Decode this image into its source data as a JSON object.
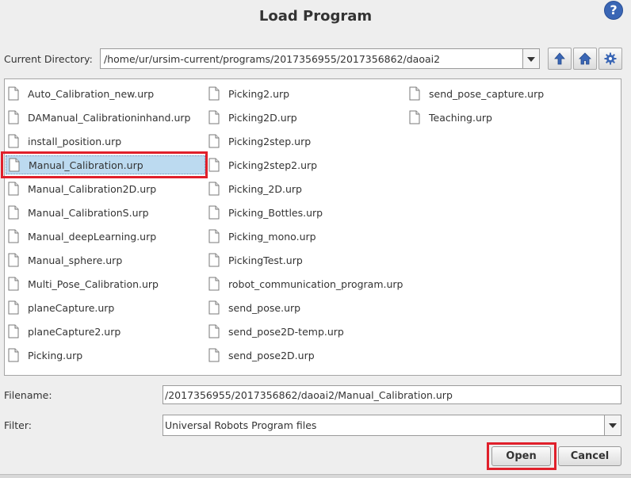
{
  "dialog": {
    "title": "Load Program",
    "help_label": "?"
  },
  "directory": {
    "label": "Current Directory:",
    "value": "/home/ur/ursim-current/programs/2017356955/2017356862/daoai2"
  },
  "toolbar": {
    "up_icon": "arrow-up-icon",
    "home_icon": "home-icon",
    "settings_icon": "gear-icon"
  },
  "files": {
    "col1": [
      "Auto_Calibration_new.urp",
      "DAManual_Calibrationinhand.urp",
      "install_position.urp",
      "Manual_Calibration.urp",
      "Manual_Calibration2D.urp",
      "Manual_CalibrationS.urp",
      "Manual_deepLearning.urp",
      "Manual_sphere.urp",
      "Multi_Pose_Calibration.urp",
      "planeCapture.urp",
      "planeCapture2.urp",
      "Picking.urp"
    ],
    "col2": [
      "Picking2.urp",
      "Picking2D.urp",
      "Picking2step.urp",
      "Picking2step2.urp",
      "Picking_2D.urp",
      "Picking_Bottles.urp",
      "Picking_mono.urp",
      "PickingTest.urp",
      "robot_communication_program.urp",
      "send_pose.urp",
      "send_pose2D-temp.urp",
      "send_pose2D.urp"
    ],
    "col3": [
      "send_pose_capture.urp",
      "Teaching.urp"
    ],
    "selected": "Manual_Calibration.urp"
  },
  "filename": {
    "label": "Filename:",
    "value": "/2017356955/2017356862/daoai2/Manual_Calibration.urp"
  },
  "filter": {
    "label": "Filter:",
    "value": "Universal Robots Program files"
  },
  "buttons": {
    "open": "Open",
    "cancel": "Cancel"
  },
  "colors": {
    "highlight": "#e0202b",
    "selection": "#bcdaf0",
    "accent": "#3a66b5"
  }
}
